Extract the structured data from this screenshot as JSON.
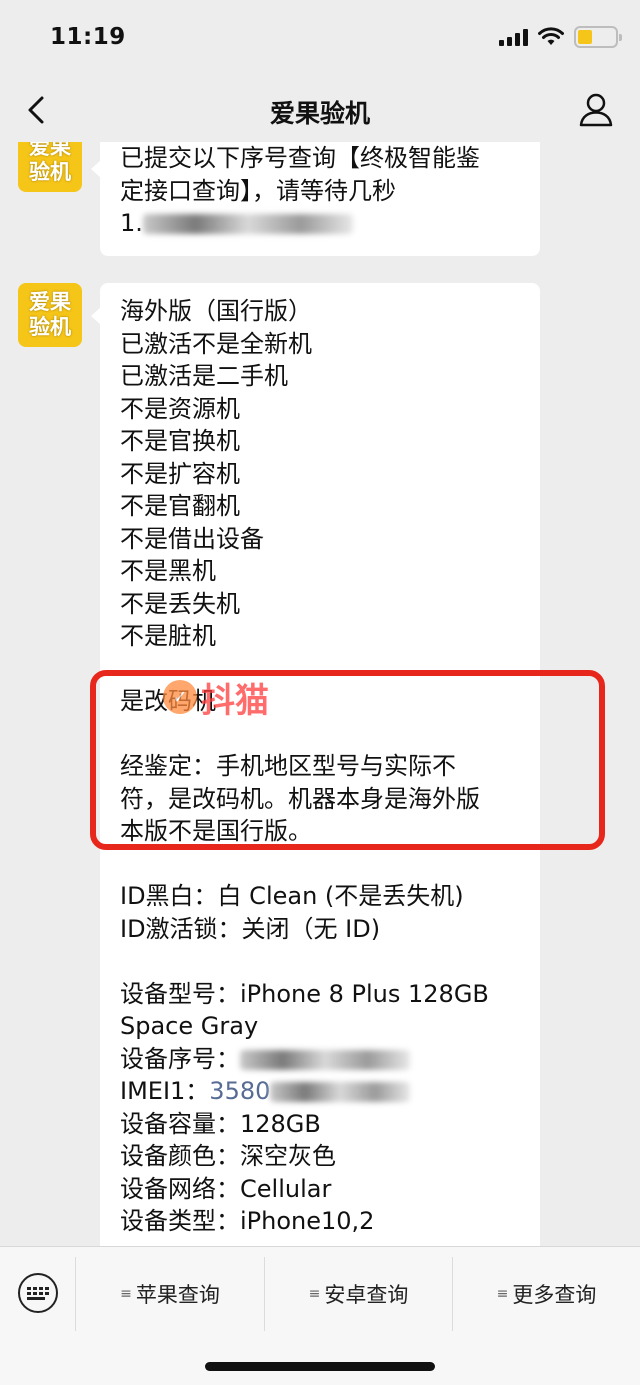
{
  "status_bar": {
    "time": "11:19",
    "battery_level": 0.4
  },
  "nav": {
    "title": "爱果验机",
    "back_icon": "chevron-left-icon",
    "profile_icon": "user-icon"
  },
  "avatar": {
    "line1": "爱果",
    "line2": "验机"
  },
  "messages": [
    {
      "lines": [
        "已提交以下序号查询【终极智能鉴",
        "定接口查询】，请等待几秒",
        "1."
      ]
    },
    {
      "lines_top": [
        "海外版（国行版）",
        "已激活不是全新机",
        "已激活是二手机",
        "不是资源机",
        "不是官换机",
        "不是扩容机",
        "不是官翻机",
        "不是借出设备",
        "不是黑机",
        "不是丢失机",
        "不是脏机"
      ],
      "lines_highlight": [
        "是改码机",
        "经鉴定：手机地区型号与实际不",
        "符，是改码机。机器本身是海外版",
        "本版不是国行版。"
      ],
      "lines_id": [
        "ID黑白：白 Clean (不是丢失机)",
        "ID激活锁：关闭（无 ID)"
      ],
      "device": {
        "model_line1": "设备型号：iPhone 8 Plus 128GB",
        "model_line2": "Space Gray",
        "serial_label": "设备序号：",
        "imei_label": "IMEI1：",
        "imei_value": "3580",
        "capacity": "设备容量：128GB",
        "color": "设备颜色：深空灰色",
        "network": "设备网络：Cellular",
        "type": "设备类型：iPhone10,2"
      }
    }
  ],
  "watermark": {
    "text": "抖猫"
  },
  "menu": {
    "keyboard_icon": "keyboard-icon",
    "items": [
      "苹果查询",
      "安卓查询",
      "更多查询"
    ],
    "item_icon": "menu-lines-icon"
  }
}
